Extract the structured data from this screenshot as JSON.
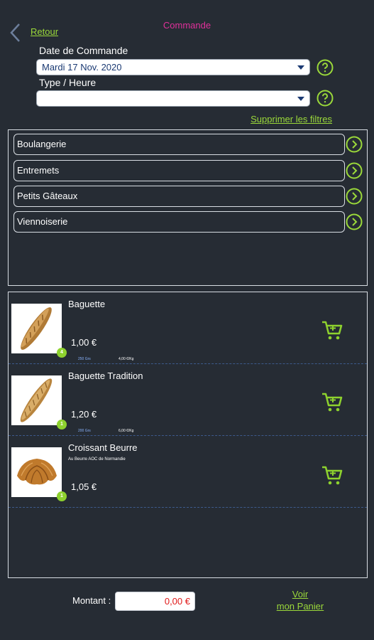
{
  "header": {
    "back_label": "Retour",
    "title": "Commande"
  },
  "filters": {
    "date_label": "Date de Commande",
    "date_value": "Mardi 17 Nov. 2020",
    "type_label": "Type / Heure",
    "type_value": "",
    "clear_label": "Supprimer les filtres"
  },
  "categories": [
    {
      "label": "Boulangerie"
    },
    {
      "label": "Entremets"
    },
    {
      "label": "Petits Gâteaux"
    },
    {
      "label": "Viennoiserie"
    }
  ],
  "products": [
    {
      "name": "Baguette",
      "subtitle": "",
      "price": "1,00 €",
      "weight": "250 Grs",
      "per_kg": "4,00 €/Kg",
      "badge": "4"
    },
    {
      "name": "Baguette Tradition",
      "subtitle": "",
      "price": "1,20 €",
      "weight": "200 Grs",
      "per_kg": "6,00 €/Kg",
      "badge": "1"
    },
    {
      "name": "Croissant Beurre",
      "subtitle": "Au Beurre AOC de Normandie",
      "price": "1,05 €",
      "weight": "",
      "per_kg": "",
      "badge": "1"
    }
  ],
  "footer": {
    "amount_label": "Montant :",
    "amount_value": "0,00 €",
    "basket_line1": "Voir",
    "basket_line2": "mon Panier"
  },
  "colors": {
    "background": "#262c34",
    "accent_green": "#9bd93a",
    "title_pink": "#e0309a",
    "amount_red": "#e01818"
  },
  "icons": [
    "back-chevron-icon",
    "help-icon",
    "arrow-right-circle-icon",
    "cart-icon"
  ]
}
